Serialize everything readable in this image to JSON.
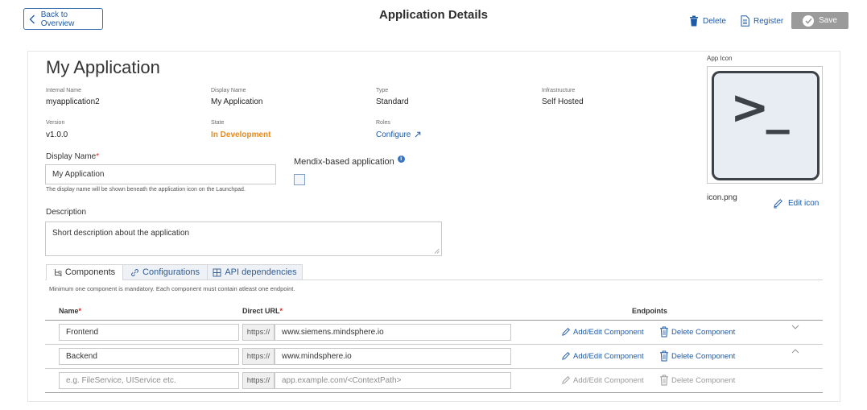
{
  "header": {
    "back_label": "Back to Overview",
    "title": "Application Details",
    "delete_label": "Delete",
    "register_label": "Register",
    "save_label": "Save"
  },
  "app": {
    "name": "My Application",
    "meta": [
      {
        "label": "Internal Name",
        "value": "myapplication2"
      },
      {
        "label": "Display Name",
        "value": "My Application"
      },
      {
        "label": "Type",
        "value": "Standard"
      },
      {
        "label": "Infrastructure",
        "value": "Self Hosted"
      },
      {
        "label": "Version",
        "value": "v1.0.0"
      },
      {
        "label": "State",
        "value": "In Development"
      },
      {
        "label": "Roles",
        "value": "Configure"
      }
    ]
  },
  "form": {
    "display_name_label": "Display Name",
    "display_name_value": "My Application",
    "display_name_hint": "The display name will be shown beneath the application icon on the Launchpad.",
    "mendix_label": "Mendix-based application",
    "info_glyph": "i",
    "description_label": "Description",
    "description_value": "Short description about the application"
  },
  "icon_panel": {
    "label": "App Icon",
    "filename": "icon.png",
    "edit_label": "Edit icon",
    "glyph": ">_"
  },
  "tabs": [
    {
      "label": "Components",
      "icon": "components-icon",
      "active": true
    },
    {
      "label": "Configurations",
      "icon": "link-icon",
      "active": false
    },
    {
      "label": "API dependencies",
      "icon": "api-icon",
      "active": false
    }
  ],
  "components": {
    "hint": "Minimum one component is mandatory. Each component must contain atleast one endpoint.",
    "col_name": "Name",
    "col_url": "Direct URL",
    "col_endpoints": "Endpoints",
    "required_mark": "*",
    "prefix": "https://",
    "add_edit_label": "Add/Edit Component",
    "delete_label": "Delete Component",
    "rows": [
      {
        "name": "Frontend",
        "url": "www.siemens.mindsphere.io",
        "caret": "down"
      },
      {
        "name": "Backend",
        "url": "www.mindsphere.io",
        "caret": "up"
      },
      {
        "name_placeholder": "e.g. FileService, UIService etc.",
        "url_placeholder": "app.example.com/<ContextPath>",
        "disabled": true
      }
    ]
  },
  "colors": {
    "accent": "#1f5aa6",
    "state_orange": "#e88b1c",
    "required_red": "#d9241b",
    "save_gray": "#9b9b9b"
  }
}
